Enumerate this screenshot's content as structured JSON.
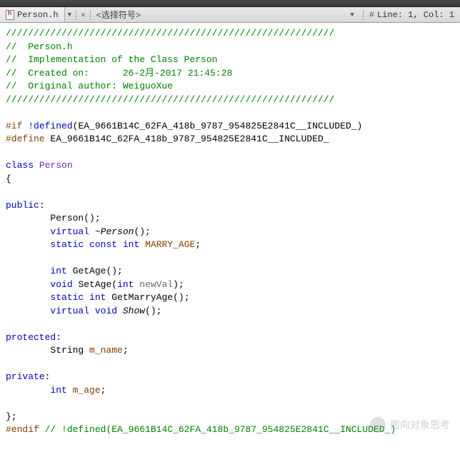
{
  "top": {
    "file_tab_label": "Person.h",
    "symbol_picker_label": "<选择符号>",
    "status_text": "Line: 1, Col: 1"
  },
  "code": {
    "lines": [
      [
        [
          "comment",
          "///////////////////////////////////////////////////////////"
        ]
      ],
      [
        [
          "comment",
          "//  Person.h"
        ]
      ],
      [
        [
          "comment",
          "//  Implementation of the Class Person"
        ]
      ],
      [
        [
          "comment",
          "//  Created on:      26-2月-2017 21:45:28"
        ]
      ],
      [
        [
          "comment",
          "//  Original author: WeiguoXue"
        ]
      ],
      [
        [
          "comment",
          "///////////////////////////////////////////////////////////"
        ]
      ],
      [],
      [
        [
          "pre",
          "#if"
        ],
        [
          "plain",
          " "
        ],
        [
          "kw",
          "!defined"
        ],
        [
          "plain",
          "(EA_9661B14C_62FA_418b_9787_954825E2841C__INCLUDED_)"
        ]
      ],
      [
        [
          "pre",
          "#define"
        ],
        [
          "plain",
          " EA_9661B14C_62FA_418b_9787_954825E2841C__INCLUDED_"
        ]
      ],
      [],
      [
        [
          "kw",
          "class"
        ],
        [
          "plain",
          " "
        ],
        [
          "clsname",
          "Person"
        ]
      ],
      [
        [
          "plain",
          "{"
        ]
      ],
      [],
      [
        [
          "kw",
          "public"
        ],
        [
          "plain",
          ":"
        ]
      ],
      [
        [
          "plain",
          "        "
        ],
        [
          "method",
          "Person"
        ],
        [
          "plain",
          "();"
        ]
      ],
      [
        [
          "plain",
          "        "
        ],
        [
          "kw",
          "virtual"
        ],
        [
          "plain",
          " "
        ],
        [
          "dtor",
          "~Person"
        ],
        [
          "plain",
          "();"
        ]
      ],
      [
        [
          "plain",
          "        "
        ],
        [
          "kw",
          "static"
        ],
        [
          "plain",
          " "
        ],
        [
          "kw",
          "const"
        ],
        [
          "plain",
          " "
        ],
        [
          "kw",
          "int"
        ],
        [
          "plain",
          " "
        ],
        [
          "member",
          "MARRY_AGE"
        ],
        [
          "plain",
          ";"
        ]
      ],
      [],
      [
        [
          "plain",
          "        "
        ],
        [
          "kw",
          "int"
        ],
        [
          "plain",
          " "
        ],
        [
          "method",
          "GetAge"
        ],
        [
          "plain",
          "();"
        ]
      ],
      [
        [
          "plain",
          "        "
        ],
        [
          "kw",
          "void"
        ],
        [
          "plain",
          " "
        ],
        [
          "method",
          "SetAge"
        ],
        [
          "plain",
          "("
        ],
        [
          "kw",
          "int"
        ],
        [
          "plain",
          " "
        ],
        [
          "ident",
          "newVal"
        ],
        [
          "plain",
          ");"
        ]
      ],
      [
        [
          "plain",
          "        "
        ],
        [
          "kw",
          "static"
        ],
        [
          "plain",
          " "
        ],
        [
          "kw",
          "int"
        ],
        [
          "plain",
          " "
        ],
        [
          "method",
          "GetMarryAge"
        ],
        [
          "plain",
          "();"
        ]
      ],
      [
        [
          "plain",
          "        "
        ],
        [
          "kw",
          "virtual"
        ],
        [
          "plain",
          " "
        ],
        [
          "kw",
          "void"
        ],
        [
          "plain",
          " "
        ],
        [
          "dtor",
          "Show"
        ],
        [
          "plain",
          "();"
        ]
      ],
      [],
      [
        [
          "kw",
          "protected"
        ],
        [
          "plain",
          ":"
        ]
      ],
      [
        [
          "plain",
          "        String "
        ],
        [
          "member2",
          "m_name"
        ],
        [
          "plain",
          ";"
        ]
      ],
      [],
      [
        [
          "kw",
          "private"
        ],
        [
          "plain",
          ":"
        ]
      ],
      [
        [
          "plain",
          "        "
        ],
        [
          "kw",
          "int"
        ],
        [
          "plain",
          " "
        ],
        [
          "member2",
          "m_age"
        ],
        [
          "plain",
          ";"
        ]
      ],
      [],
      [
        [
          "plain",
          "};"
        ]
      ],
      [
        [
          "pre",
          "#endif"
        ],
        [
          "plain",
          " "
        ],
        [
          "comment",
          "// !defined(EA_9661B14C_62FA_418b_9787_954825E2841C__INCLUDED_)"
        ]
      ]
    ]
  },
  "watermark": {
    "text": "面向对象思考"
  }
}
